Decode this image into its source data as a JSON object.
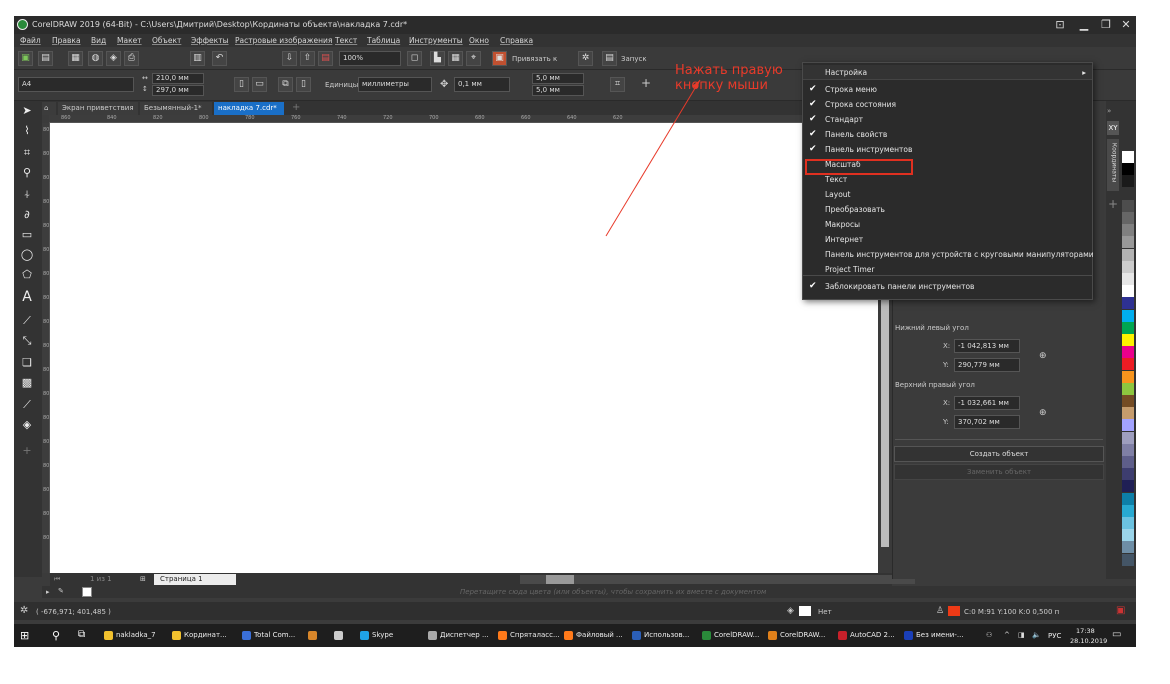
{
  "window": {
    "title": "CorelDRAW 2019 (64-Bit) - C:\\Users\\Дмитрий\\Desktop\\Кординаты объекта\\накладка 7.cdr*",
    "controls": [
      "▁",
      "❐",
      "✕"
    ]
  },
  "menubar": [
    "Файл",
    "Правка",
    "Вид",
    "Макет",
    "Объект",
    "Эффекты",
    "Растровые изображения",
    "Текст",
    "Таблица",
    "Инструменты",
    "Окно",
    "Справка"
  ],
  "standard_toolbar": {
    "zoom": "100%",
    "snap": "Привязать к",
    "launch": "Запуск"
  },
  "property_bar": {
    "page_size": "A4",
    "width": "210,0 мм",
    "height": "297,0 мм",
    "units_label": "Единицы:",
    "units_value": "миллиметры",
    "nudge": "0,1 мм",
    "dup_x": "5,0 мм",
    "dup_y": "5,0 мм"
  },
  "tabs": [
    {
      "label": "Экран приветствия"
    },
    {
      "label": "Безымянный-1*"
    },
    {
      "label": "накладка 7.cdr*"
    }
  ],
  "ruler_h": [
    "860",
    "840",
    "820",
    "800",
    "780",
    "760",
    "740",
    "720",
    "700",
    "680",
    "660",
    "640",
    "620"
  ],
  "ruler_v": [
    "80",
    "80",
    "80",
    "80",
    "80",
    "80",
    "80",
    "80",
    "80",
    "80",
    "80",
    "80",
    "80",
    "80",
    "80",
    "80",
    "80",
    "80"
  ],
  "page_nav": {
    "counter": "1 из 1",
    "page_tab": "Страница 1"
  },
  "docker": {
    "bottom_left_label": "Нижний левый угол",
    "bl_x": "-1 042,813 мм",
    "bl_y": "290,779 мм",
    "top_right_label": "Верхний правый угол",
    "tr_x": "-1 032,661 мм",
    "tr_y": "370,702 мм",
    "x_label": "X:",
    "y_label": "Y:",
    "create_button": "Создать объект",
    "replace_button": "Заменить объект",
    "dock_tab": "Координаты"
  },
  "doc_palette_hint": "Перетащите сюда цвета (или объекты), чтобы сохранить их вместе с документом",
  "status": {
    "coords": "( -676,971; 401,485 )",
    "fill": "Нет",
    "outline": "C:0 M:91 Y:100 K:0  0,500 п"
  },
  "context_menu": {
    "items": [
      {
        "label": "Настройка",
        "checked": false,
        "submenu": true
      },
      {
        "label": "Строка меню",
        "checked": true
      },
      {
        "label": "Строка состояния",
        "checked": true
      },
      {
        "label": "Стандарт",
        "checked": true
      },
      {
        "label": "Панель свойств",
        "checked": true
      },
      {
        "label": "Панель инструментов",
        "checked": true
      },
      {
        "label": "Масштаб",
        "checked": false
      },
      {
        "label": "Текст",
        "checked": false
      },
      {
        "label": "Layout",
        "checked": false
      },
      {
        "label": "Преобразовать",
        "checked": false
      },
      {
        "label": "Макросы",
        "checked": false
      },
      {
        "label": "Интернет",
        "checked": false
      },
      {
        "label": "Панель инструментов для устройств с круговыми манипуляторами",
        "checked": false
      },
      {
        "label": "Project Timer",
        "checked": false
      },
      {
        "label": "Заблокировать панели инструментов",
        "checked": true
      }
    ]
  },
  "annotation": {
    "line1": "Нажать правую",
    "line2": "кнопку мыши",
    "color": "#e83a2a"
  },
  "taskbar": {
    "items": [
      {
        "label": "nakladka_7",
        "color": "#f2c12e"
      },
      {
        "label": "Кординат...",
        "color": "#f2c12e"
      },
      {
        "label": "Total Com...",
        "color": "#3a6fd8"
      },
      {
        "label": "",
        "color": "#d8862a"
      },
      {
        "label": "",
        "color": "#cccccc"
      },
      {
        "label": "Skype",
        "color": "#1fa3e8"
      },
      {
        "label": "Диспетчер ...",
        "color": "#aaaaaa"
      },
      {
        "label": "Спряталасс...",
        "color": "#ff7a1a"
      },
      {
        "label": "Файловый ...",
        "color": "#ff7a1a"
      },
      {
        "label": "Использов...",
        "color": "#2b5fb8"
      },
      {
        "label": "CorelDRAW...",
        "color": "#2a8a3a"
      },
      {
        "label": "CorelDRAW...",
        "color": "#e0801a"
      },
      {
        "label": "AutoCAD 2...",
        "color": "#c8202a"
      },
      {
        "label": "Без имени-...",
        "color": "#1a3fb8"
      }
    ],
    "lang": "РУС",
    "time": "17:38",
    "date": "28.10.2019"
  }
}
